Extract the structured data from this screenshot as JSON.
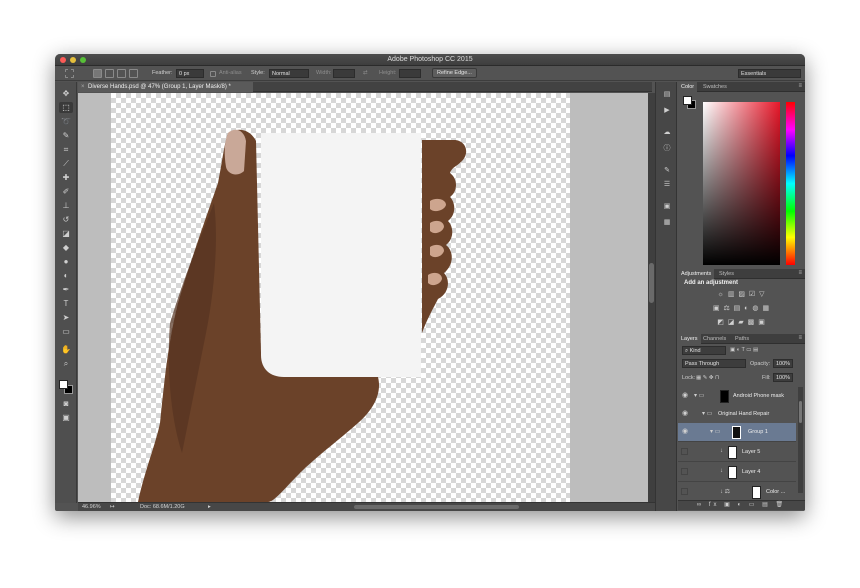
{
  "window": {
    "title": "Adobe Photoshop CC 2015",
    "traffic_colors": [
      "#fc5b57",
      "#e5bf3c",
      "#57c038"
    ]
  },
  "options_bar": {
    "feather_label": "Feather:",
    "feather_value": "0 px",
    "anti_alias_label": "Anti-alias",
    "style_label": "Style:",
    "style_value": "Normal",
    "width_label": "Width:",
    "height_label": "Height:",
    "refine_edge_button": "Refine Edge...",
    "workspace_value": "Essentials"
  },
  "toolbar": {
    "tools": [
      "move-tool",
      "marquee-tool",
      "lasso-tool",
      "quick-selection-tool",
      "crop-tool",
      "eyedropper-tool",
      "healing-brush-tool",
      "brush-tool",
      "clone-stamp-tool",
      "history-brush-tool",
      "eraser-tool",
      "paint-bucket-tool",
      "blur-tool",
      "dodge-tool",
      "pen-tool",
      "type-tool",
      "path-selection-tool",
      "rectangle-tool",
      "hand-tool",
      "zoom-tool"
    ],
    "selected_tool": "marquee-tool",
    "foreground_color": "#ffffff",
    "background_color": "#000000"
  },
  "document": {
    "tab_title": "Diverse Hands.psd @ 47% (Group 1, Layer Mask/8) *",
    "close_glyph": "×"
  },
  "status_bar": {
    "zoom": "46.96%",
    "doc_size": "Doc: 68.6M/1.20G"
  },
  "color_panel": {
    "tabs": [
      "Color",
      "Swatches"
    ],
    "active_tab": "Color",
    "foreground": "#ffffff",
    "background": "#000000",
    "spectrum_hue": "#e8182a"
  },
  "adjustments_panel": {
    "tabs": [
      "Adjustments",
      "Styles"
    ],
    "active_tab": "Adjustments",
    "heading": "Add an adjustment"
  },
  "layers_panel": {
    "tabs": [
      "Layers",
      "Channels",
      "Paths"
    ],
    "active_tab": "Layers",
    "filter_value": "Kind",
    "blend_mode": "Pass Through",
    "opacity_label": "Opacity:",
    "opacity_value": "100%",
    "lock_label": "Lock:",
    "fill_label": "Fill:",
    "fill_value": "100%",
    "layers": [
      {
        "name": "Android Phone mask",
        "type": "group",
        "visible": true,
        "selected": false,
        "indent": 0
      },
      {
        "name": "Original Hand Repair",
        "type": "group",
        "visible": true,
        "selected": false,
        "indent": 1
      },
      {
        "name": "Group 1",
        "type": "group-masked",
        "visible": true,
        "selected": true,
        "indent": 2
      },
      {
        "name": "Layer 5",
        "type": "layer",
        "visible": false,
        "selected": false,
        "indent": 3
      },
      {
        "name": "Layer 4",
        "type": "layer",
        "visible": false,
        "selected": false,
        "indent": 3
      },
      {
        "name": "Color ...",
        "type": "adjustment",
        "visible": false,
        "selected": false,
        "indent": 3
      }
    ]
  }
}
